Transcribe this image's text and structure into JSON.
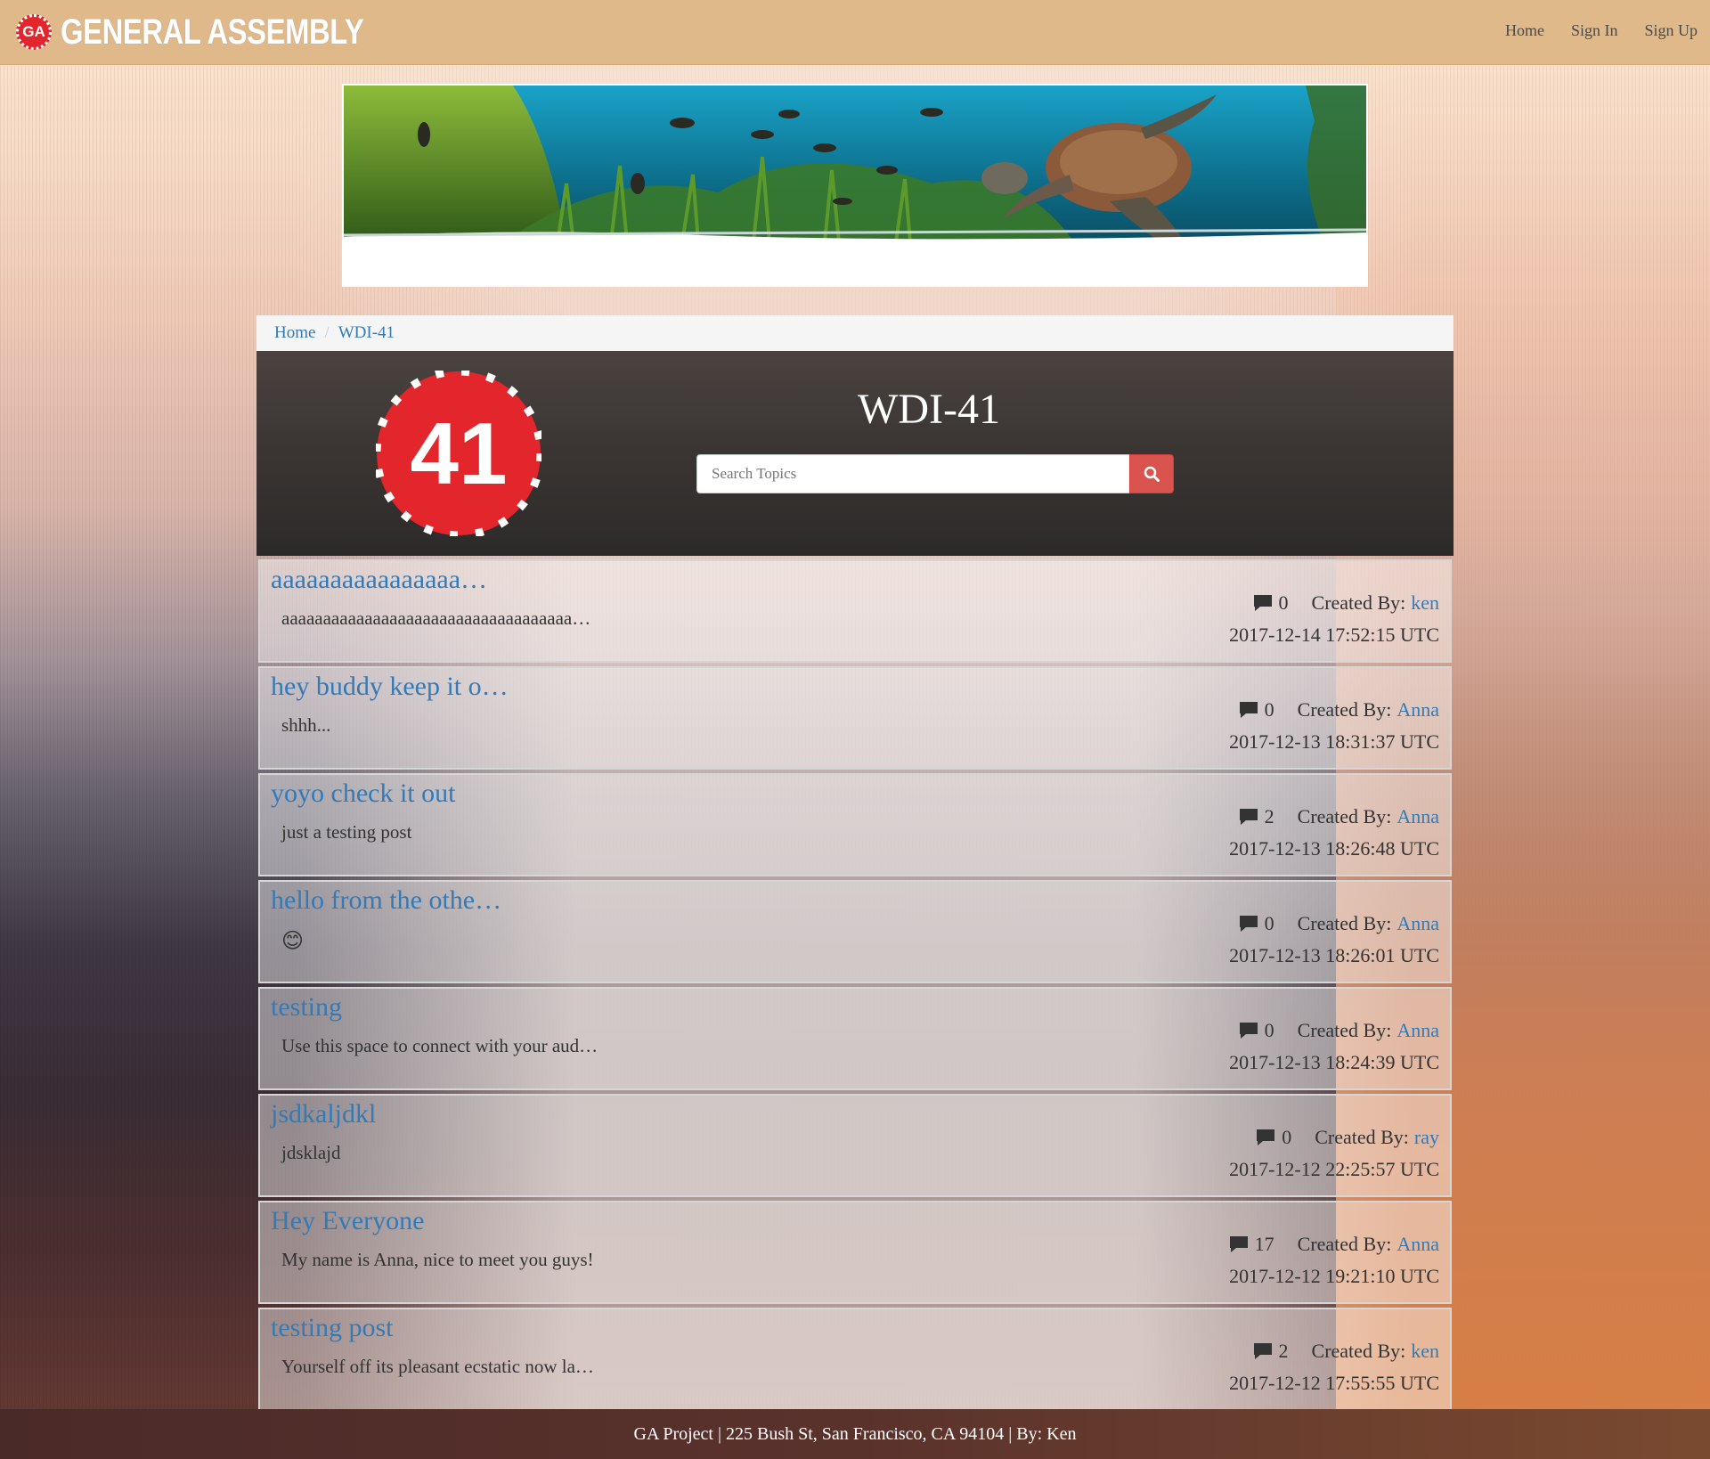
{
  "brand": {
    "badge": "GA",
    "name": "GENERAL ASSEMBLY"
  },
  "nav": {
    "home": "Home",
    "sign_in": "Sign In",
    "sign_up": "Sign Up"
  },
  "breadcrumb": {
    "home": "Home",
    "current": "WDI-41"
  },
  "hero": {
    "title": "WDI-41",
    "logo_text": "41",
    "search_placeholder": "Search Topics"
  },
  "topics": [
    {
      "title": "aaaaaaaaaaaaaaaa…",
      "body": "aaaaaaaaaaaaaaaaaaaaaaaaaaaaaaaaaaa…",
      "comments": "0",
      "created_label": "Created By:",
      "author": "ken",
      "timestamp": "2017-12-14 17:52:15 UTC"
    },
    {
      "title": "hey buddy keep it o…",
      "body": "shhh...",
      "comments": "0",
      "created_label": "Created By:",
      "author": "Anna",
      "timestamp": "2017-12-13 18:31:37 UTC"
    },
    {
      "title": "yoyo check it out",
      "body": "just a testing post",
      "comments": "2",
      "created_label": "Created By:",
      "author": "Anna",
      "timestamp": "2017-12-13 18:26:48 UTC"
    },
    {
      "title": "hello from the othe…",
      "body": "😊",
      "comments": "0",
      "created_label": "Created By:",
      "author": "Anna",
      "timestamp": "2017-12-13 18:26:01 UTC"
    },
    {
      "title": "testing",
      "body": "Use this space to connect with your aud…",
      "comments": "0",
      "created_label": "Created By:",
      "author": "Anna",
      "timestamp": "2017-12-13 18:24:39 UTC"
    },
    {
      "title": "jsdkaljdkl",
      "body": "jdsklajd",
      "comments": "0",
      "created_label": "Created By:",
      "author": "ray",
      "timestamp": "2017-12-12 22:25:57 UTC"
    },
    {
      "title": "Hey Everyone",
      "body": "My name is Anna, nice to meet you guys!",
      "comments": "17",
      "created_label": "Created By:",
      "author": "Anna",
      "timestamp": "2017-12-12 19:21:10 UTC"
    },
    {
      "title": "testing post",
      "body": "Yourself off its pleasant ecstatic now la…",
      "comments": "2",
      "created_label": "Created By:",
      "author": "ken",
      "timestamp": "2017-12-12 17:55:55 UTC"
    }
  ],
  "footer": {
    "text": "GA Project | 225 Bush St, San Francisco, CA 94104 | By: Ken"
  },
  "colors": {
    "navbar": "#e0b98b",
    "link": "#337ab7",
    "accent_red": "#e2262b",
    "search_button": "#d9534f"
  },
  "icons": {
    "search": "search-icon",
    "comment": "comment-icon"
  }
}
